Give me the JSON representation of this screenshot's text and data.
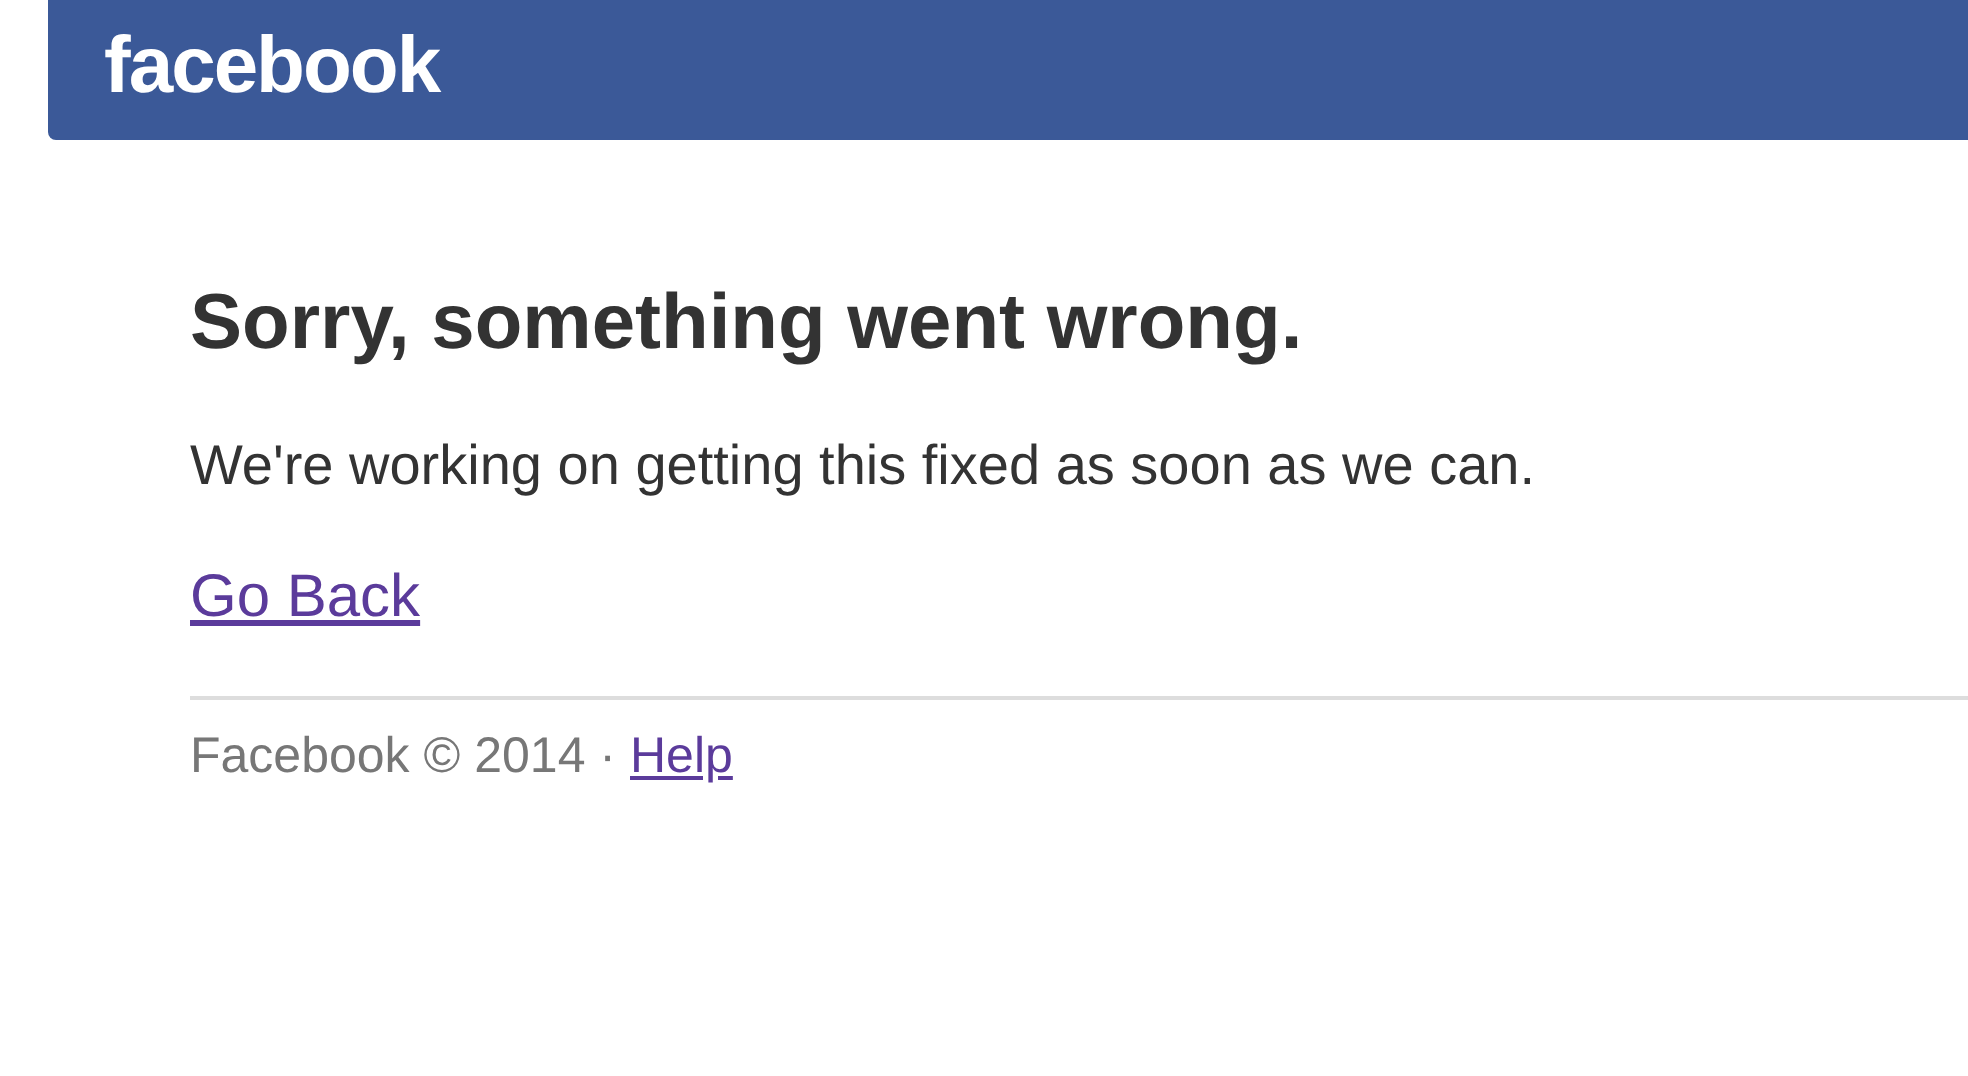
{
  "header": {
    "logo": "facebook"
  },
  "error": {
    "title": "Sorry, something went wrong.",
    "message": "We're working on getting this fixed as soon as we can.",
    "link": "Go Back"
  },
  "footer": {
    "text": "Facebook © 2014 ·",
    "link": "Help"
  }
}
